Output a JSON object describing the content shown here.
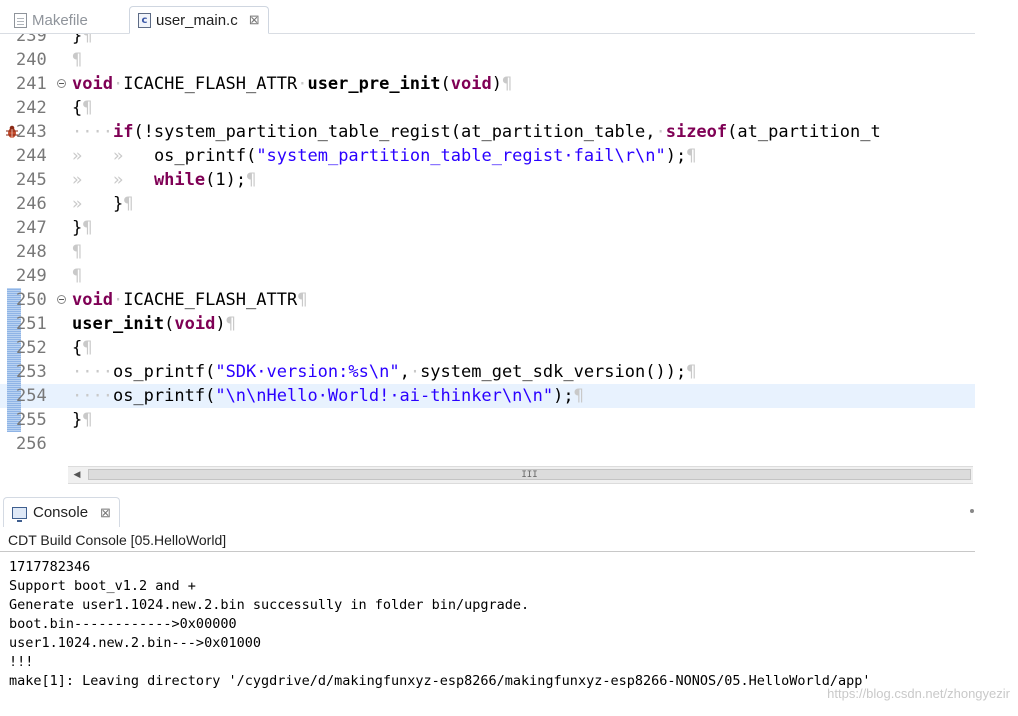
{
  "editor_tabs": [
    {
      "label": "Makefile",
      "active": false
    },
    {
      "label": "user_main.c",
      "active": true,
      "close": "⊠"
    }
  ],
  "code_lines": [
    {
      "num": "239",
      "text": "}¶"
    },
    {
      "num": "240",
      "text": "¶"
    },
    {
      "num": "241",
      "text": "void·ICACHE_FLASH_ATTR·user_pre_init(void)¶"
    },
    {
      "num": "242",
      "text": "{¶"
    },
    {
      "num": "243",
      "text": "····if(!system_partition_table_regist(at_partition_table,·sizeof(at_partition_t"
    },
    {
      "num": "244",
      "text": "»   »   os_printf(\"system_partition_table_regist·fail\\r\\n\");¶"
    },
    {
      "num": "245",
      "text": "»   »   while(1);¶"
    },
    {
      "num": "246",
      "text": "»   }¶"
    },
    {
      "num": "247",
      "text": "}¶"
    },
    {
      "num": "248",
      "text": "¶"
    },
    {
      "num": "249",
      "text": "¶"
    },
    {
      "num": "250",
      "text": "void·ICACHE_FLASH_ATTR¶"
    },
    {
      "num": "251",
      "text": "user_init(void)¶"
    },
    {
      "num": "252",
      "text": "{¶"
    },
    {
      "num": "253",
      "text": "····os_printf(\"SDK·version:%s\\n\",·system_get_sdk_version());¶"
    },
    {
      "num": "254",
      "text": "····os_printf(\"\\n\\nHello·World!·ai-thinker\\n\\n\");¶"
    },
    {
      "num": "255",
      "text": "}¶"
    },
    {
      "num": "256",
      "text": ""
    }
  ],
  "scrollbar": {
    "grip": "III"
  },
  "console": {
    "tab_label": "Console",
    "tab_close": "⊠",
    "title": "CDT Build Console [05.HelloWorld]",
    "lines": [
      "1717782346",
      "Support boot_v1.2 and +",
      "Generate user1.1024.new.2.bin successully in folder bin/upgrade.",
      "boot.bin------------>0x00000",
      "user1.1024.new.2.bin--->0x01000",
      "!!!",
      "make[1]: Leaving directory '/cygdrive/d/makingfunxyz-esp8266/makingfunxyz-esp8266-NONOS/05.HelloWorld/app'"
    ]
  },
  "watermark": "https://blog.csdn.net/zhongyezir",
  "colors": {
    "keyword": "#7f0055",
    "string": "#2a00ff",
    "line_number": "#787878",
    "current_line": "#e8f2fe",
    "whitespace_marker": "#c9c9c9"
  }
}
